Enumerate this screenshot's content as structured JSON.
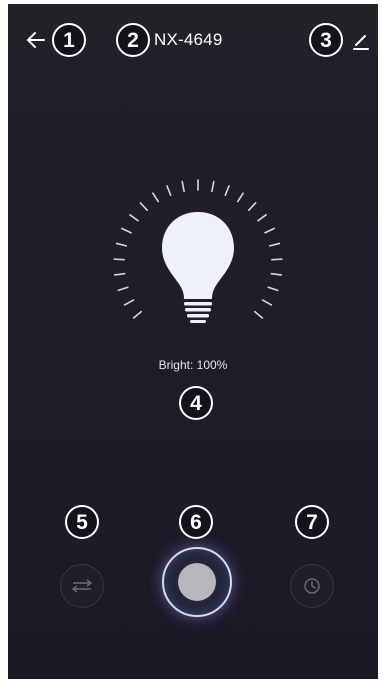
{
  "header": {
    "device_name": "NX-4649",
    "back_icon": "back-arrow-icon",
    "edit_icon": "pencil-edit-icon"
  },
  "markers": {
    "m1": "1",
    "m2": "2",
    "m3": "3",
    "m4": "4",
    "m5": "5",
    "m6": "6",
    "m7": "7"
  },
  "lamp": {
    "brightness_label": "Bright: 100%",
    "brightness_percent": 100,
    "bulb_color": "#eef0fb",
    "tick_color": "#d8d6e0"
  },
  "controls": {
    "scene_icon": "sliders-icon",
    "power_icon": "power-knob",
    "timer_icon": "clock-icon"
  },
  "colors": {
    "background": "#211d29",
    "power_glow": "#8296e6"
  }
}
